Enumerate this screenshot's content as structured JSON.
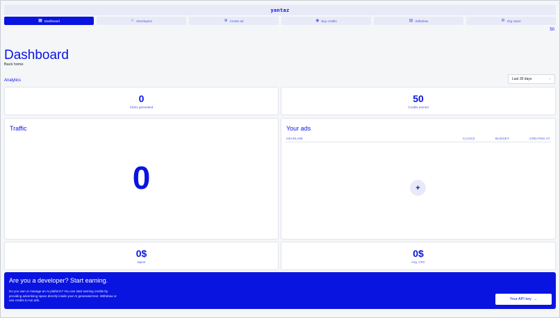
{
  "app": {
    "brand": "yantaz",
    "credits_corner": "50"
  },
  "nav": {
    "items": [
      {
        "label": "Dashboard",
        "icon": "grid-icon",
        "glyph": "▦",
        "active": true
      },
      {
        "label": "Developers",
        "icon": "star-icon",
        "glyph": "☆",
        "active": false
      },
      {
        "label": "Create ad",
        "icon": "plus-circle-icon",
        "glyph": "⊕",
        "active": false
      },
      {
        "label": "Buy credits",
        "icon": "coin-icon",
        "glyph": "◉",
        "active": false
      },
      {
        "label": "Withdraw",
        "icon": "wallet-icon",
        "glyph": "▤",
        "active": false
      },
      {
        "label": "Org name",
        "icon": "settings-icon",
        "glyph": "⚙",
        "active": false
      }
    ]
  },
  "page": {
    "title": "Dashboard",
    "back_link": "Back home"
  },
  "analytics": {
    "label": "Analytics",
    "range": "Last 30 days",
    "range_caret": "↕"
  },
  "stats": {
    "clicks_value": "0",
    "clicks_label": "Clicks generated",
    "credits_value": "50",
    "credits_label": "Credits earned",
    "spent_value": "0$",
    "spent_label": "Spent",
    "cpc_value": "0$",
    "cpc_label": "Avg. CPC"
  },
  "traffic": {
    "title": "Traffic",
    "value": "0"
  },
  "ads": {
    "title": "Your ads",
    "columns": [
      "HEADLINE",
      "CLICKS",
      "BUDGET",
      "CREATED AT"
    ],
    "add_glyph": "+"
  },
  "banner": {
    "title": "Are you a developer? Start earning.",
    "text": "Do you own or manage an AI platform? You can start earning credits by providing advertising space directly inside your AI generated text. Withdraw or use credits to run ads.",
    "button_label": "Your API key",
    "button_arrow": "→"
  },
  "colors": {
    "accent": "#0a14e0",
    "background": "#f5f6f8",
    "nav_bg": "#e8ebf7"
  }
}
